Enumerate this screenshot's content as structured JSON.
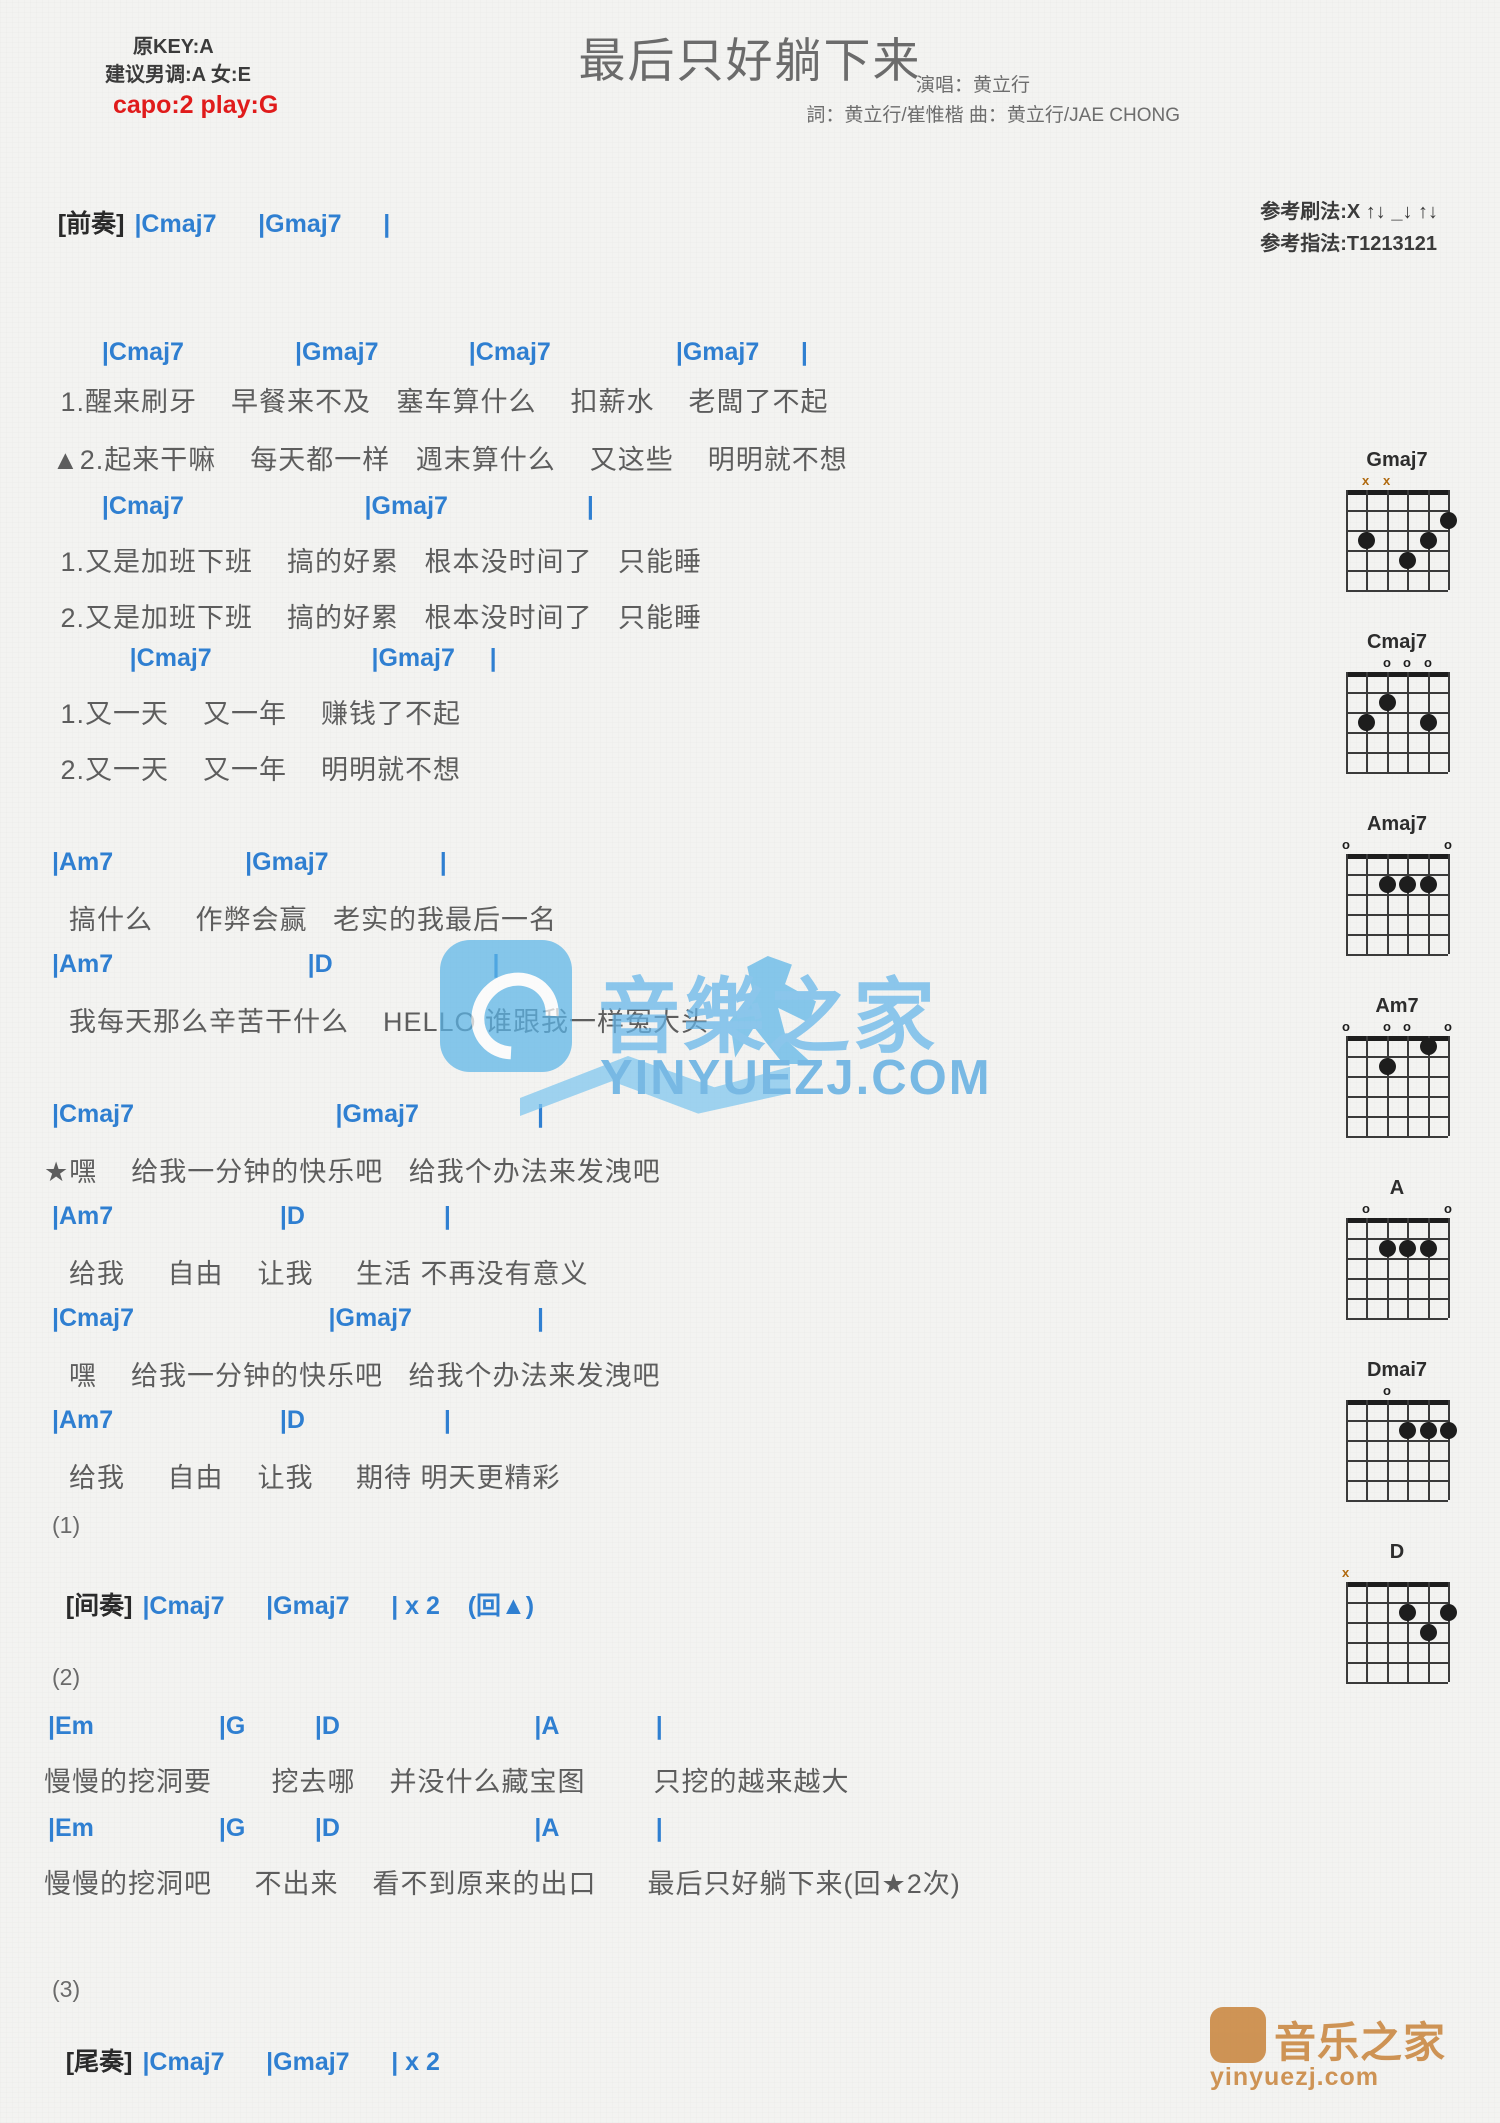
{
  "header": {
    "key_line": "原KEY:A",
    "suggest_line": "建议男调:A 女:E",
    "capo_line": "capo:2 play:G",
    "title": "最后只好躺下来",
    "singer": "演唱：黄立行",
    "writers": "詞：黄立行/崔惟楷   曲：黄立行/JAE CHONG",
    "ref_strum": "参考刷法:X ↑↓ _↓ ↑↓",
    "ref_fingering": "参考指法:T1213121",
    "capo_color": "#e01b1b",
    "chord_color": "#2f7fd1"
  },
  "intro": {
    "label": "[前奏]",
    "chords": "|Cmaj7      |Gmaj7      |"
  },
  "sections": [
    {
      "id": "verse1",
      "chords": "  |Cmaj7                |Gmaj7             |Cmaj7                  |Gmaj7      |",
      "lyrics": [
        " 1.醒来刷牙    早餐来不及   塞车算什么    扣薪水    老闆了不起",
        "▲2.起来干嘛    每天都一样   週末算什么    又这些    明明就不想"
      ]
    },
    {
      "id": "verse2",
      "chords": "  |Cmaj7                          |Gmaj7                    |",
      "lyrics": [
        " 1.又是加班下班    搞的好累   根本没时间了   只能睡",
        " 2.又是加班下班    搞的好累   根本没时间了   只能睡"
      ]
    },
    {
      "id": "verse3",
      "chords": "      |Cmaj7                       |Gmaj7     |",
      "lyrics": [
        " 1.又一天    又一年    赚钱了不起",
        " 2.又一天    又一年    明明就不想"
      ]
    },
    {
      "id": "prechorus1",
      "chords": "|Am7                   |Gmaj7                |",
      "lyrics": [
        "  搞什么     作弊会赢   老实的我最后一名"
      ]
    },
    {
      "id": "prechorus2",
      "chords": "|Am7                            |D                       |",
      "lyrics": [
        "  我每天那么辛苦干什么    HELLO 谁跟我一样冤大头"
      ]
    },
    {
      "id": "chorus1",
      "chords": "|Cmaj7                             |Gmaj7                 |",
      "lyrics": [
        "★嘿    给我一分钟的快乐吧   给我个办法来发洩吧"
      ]
    },
    {
      "id": "chorus2",
      "chords": "|Am7                        |D                    |",
      "lyrics": [
        "  给我     自由    让我     生活 不再没有意义"
      ]
    },
    {
      "id": "chorus3",
      "chords": "|Cmaj7                            |Gmaj7                  |",
      "lyrics": [
        "  嘿    给我一分钟的快乐吧   给我个办法来发洩吧"
      ]
    },
    {
      "id": "chorus4",
      "chords": "|Am7                        |D                    |",
      "lyrics": [
        "  给我     自由    让我     期待 明天更精彩"
      ]
    }
  ],
  "markers": {
    "m1": "(1)",
    "m2": "(2)",
    "m3": "(3)"
  },
  "interlude": {
    "label": "[间奏]",
    "chords": "|Cmaj7      |Gmaj7      | x 2    (回▲)"
  },
  "bridge": [
    {
      "chords": "|Em                  |G          |D                            |A              |",
      "lyrics": "慢慢的挖洞要       挖去哪    并没什么藏宝图        只挖的越来越大"
    },
    {
      "chords": "|Em                  |G          |D                            |A              |",
      "lyrics": "慢慢的挖洞吧     不出来    看不到原来的出口      最后只好躺下来(回★2次)"
    }
  ],
  "outro": {
    "label": "[尾奏]",
    "chords": "|Cmaj7      |Gmaj7      | x 2"
  },
  "watermark": {
    "brand_cn": "音樂之家",
    "brand_en": "YINYUEZJ.COM",
    "footer_cn": "音乐之家",
    "footer_en": "yinyuezj.com"
  },
  "chord_diagrams": [
    {
      "name": "Gmaj7",
      "markers": [
        " ",
        "x",
        "x",
        " ",
        " ",
        " "
      ],
      "dots": [
        {
          "s": 5,
          "f": 3
        },
        {
          "s": 2,
          "f": 3
        },
        {
          "s": 3,
          "f": 4
        },
        {
          "s": 1,
          "f": 2
        }
      ]
    },
    {
      "name": "Cmaj7",
      "markers": [
        " ",
        " ",
        "o",
        "o",
        "o",
        " "
      ],
      "dots": [
        {
          "s": 5,
          "f": 3
        },
        {
          "s": 4,
          "f": 2
        },
        {
          "s": 2,
          "f": 3
        }
      ]
    },
    {
      "name": "Amaj7",
      "markers": [
        "o",
        " ",
        " ",
        " ",
        " ",
        "o"
      ],
      "dots": [
        {
          "s": 4,
          "f": 2
        },
        {
          "s": 3,
          "f": 2
        },
        {
          "s": 2,
          "f": 2
        }
      ]
    },
    {
      "name": "Am7",
      "markers": [
        "o",
        " ",
        "o",
        "o",
        " ",
        "o"
      ],
      "dots": [
        {
          "s": 4,
          "f": 2
        },
        {
          "s": 2,
          "f": 1
        }
      ]
    },
    {
      "name": "A",
      "markers": [
        " ",
        "o",
        " ",
        " ",
        " ",
        "o"
      ],
      "dots": [
        {
          "s": 4,
          "f": 2
        },
        {
          "s": 3,
          "f": 2
        },
        {
          "s": 2,
          "f": 2
        }
      ]
    },
    {
      "name": "Dmai7",
      "markers": [
        " ",
        " ",
        "o",
        " ",
        " ",
        " "
      ],
      "dots": [
        {
          "s": 3,
          "f": 2
        },
        {
          "s": 2,
          "f": 2
        },
        {
          "s": 1,
          "f": 2
        }
      ]
    },
    {
      "name": "D",
      "markers": [
        "x",
        " ",
        " ",
        " ",
        " ",
        " "
      ],
      "dots": [
        {
          "s": 3,
          "f": 2
        },
        {
          "s": 1,
          "f": 2
        },
        {
          "s": 2,
          "f": 3
        }
      ]
    }
  ]
}
